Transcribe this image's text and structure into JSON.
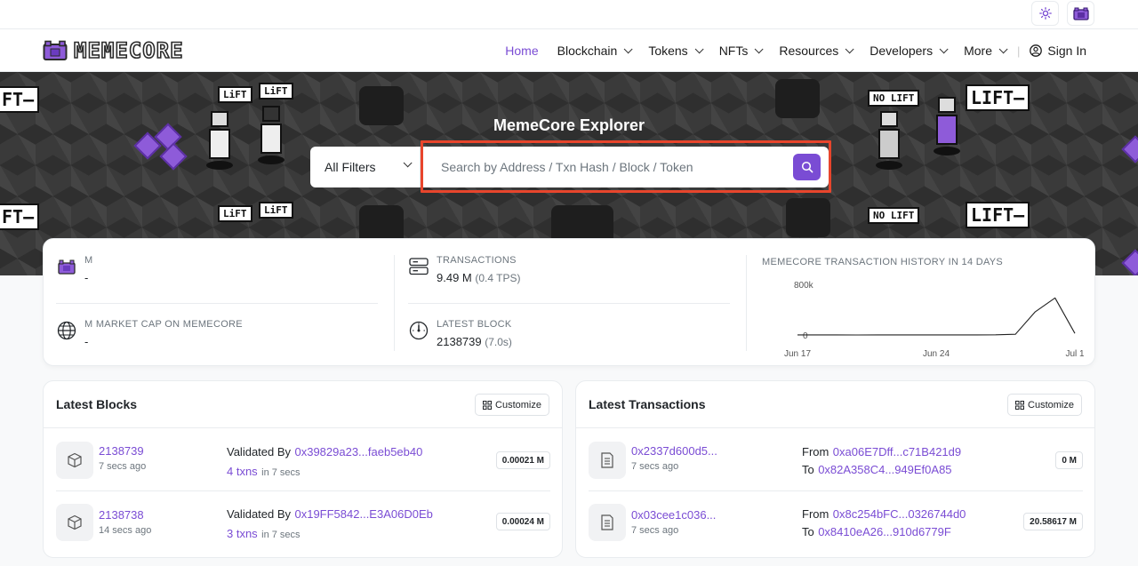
{
  "header": {
    "logo_text": "MEMECORE",
    "nav": [
      {
        "label": "Home",
        "active": true,
        "dropdown": false
      },
      {
        "label": "Blockchain",
        "dropdown": true
      },
      {
        "label": "Tokens",
        "dropdown": true
      },
      {
        "label": "NFTs",
        "dropdown": true
      },
      {
        "label": "Resources",
        "dropdown": true
      },
      {
        "label": "Developers",
        "dropdown": true
      },
      {
        "label": "More",
        "dropdown": true
      }
    ],
    "sign_in": "Sign In",
    "icons": {
      "theme": "sun-icon",
      "network": "memecore-logo-icon",
      "user": "user-circle-icon"
    }
  },
  "hero": {
    "title": "MemeCore Explorer",
    "bubbles": [
      "FT—",
      "LiFT",
      "LiFT",
      "NO LIFT",
      "LIFT—",
      "FT—",
      "LiFT",
      "LiFT",
      "NO LIFT",
      "LIFT—"
    ],
    "search": {
      "filter_label": "All Filters",
      "placeholder": "Search by Address / Txn Hash / Block / Token"
    }
  },
  "stats": {
    "price": {
      "label": "M",
      "value": "-"
    },
    "market_cap": {
      "label": "M MARKET CAP ON MEMECORE",
      "value": "-"
    },
    "transactions": {
      "label": "TRANSACTIONS",
      "value": "9.49 M",
      "sub": "(0.4 TPS)"
    },
    "latest_block": {
      "label": "LATEST BLOCK",
      "value": "2138739",
      "sub": "(7.0s)"
    }
  },
  "chart_data": {
    "type": "line",
    "title": "MEMECORE TRANSACTION HISTORY IN 14 DAYS",
    "x_ticks": [
      "Jun 17",
      "Jun 24",
      "Jul 1"
    ],
    "y_ticks": [
      "800k",
      "0"
    ],
    "ylim": [
      0,
      800000
    ],
    "x": [
      "Jun 17",
      "Jun 18",
      "Jun 19",
      "Jun 20",
      "Jun 21",
      "Jun 22",
      "Jun 23",
      "Jun 24",
      "Jun 25",
      "Jun 26",
      "Jun 27",
      "Jun 28",
      "Jun 29",
      "Jun 30",
      "Jul 1"
    ],
    "values": [
      15000,
      15000,
      16000,
      14000,
      15000,
      16000,
      15000,
      15000,
      16000,
      15000,
      17000,
      25000,
      380000,
      600000,
      40000
    ],
    "color": "#222222"
  },
  "latest_blocks": {
    "title": "Latest Blocks",
    "customize": "Customize",
    "items": [
      {
        "block": "2138739",
        "age": "7 secs ago",
        "validated_label": "Validated By",
        "validator": "0x39829a23...faeb5eb40",
        "txns": "4 txns",
        "txns_time": "in 7 secs",
        "reward": "0.00021 M"
      },
      {
        "block": "2138738",
        "age": "14 secs ago",
        "validated_label": "Validated By",
        "validator": "0x19FF5842...E3A06D0Eb",
        "txns": "3 txns",
        "txns_time": "in 7 secs",
        "reward": "0.00024 M"
      }
    ]
  },
  "latest_transactions": {
    "title": "Latest Transactions",
    "customize": "Customize",
    "items": [
      {
        "hash": "0x2337d600d5...",
        "age": "7 secs ago",
        "from_label": "From",
        "from": "0xa06E7Dff...c71B421d9",
        "to_label": "To",
        "to": "0x82A358C4...949Ef0A85",
        "value": "0 M"
      },
      {
        "hash": "0x03cee1c036...",
        "age": "7 secs ago",
        "from_label": "From",
        "from": "0x8c254bFC...0326744d0",
        "to_label": "To",
        "to": "0x8410eA26...910d6779F",
        "value": "20.58617 M"
      }
    ]
  },
  "colors": {
    "accent": "#7a4cd4",
    "highlight": "#e8452c"
  }
}
